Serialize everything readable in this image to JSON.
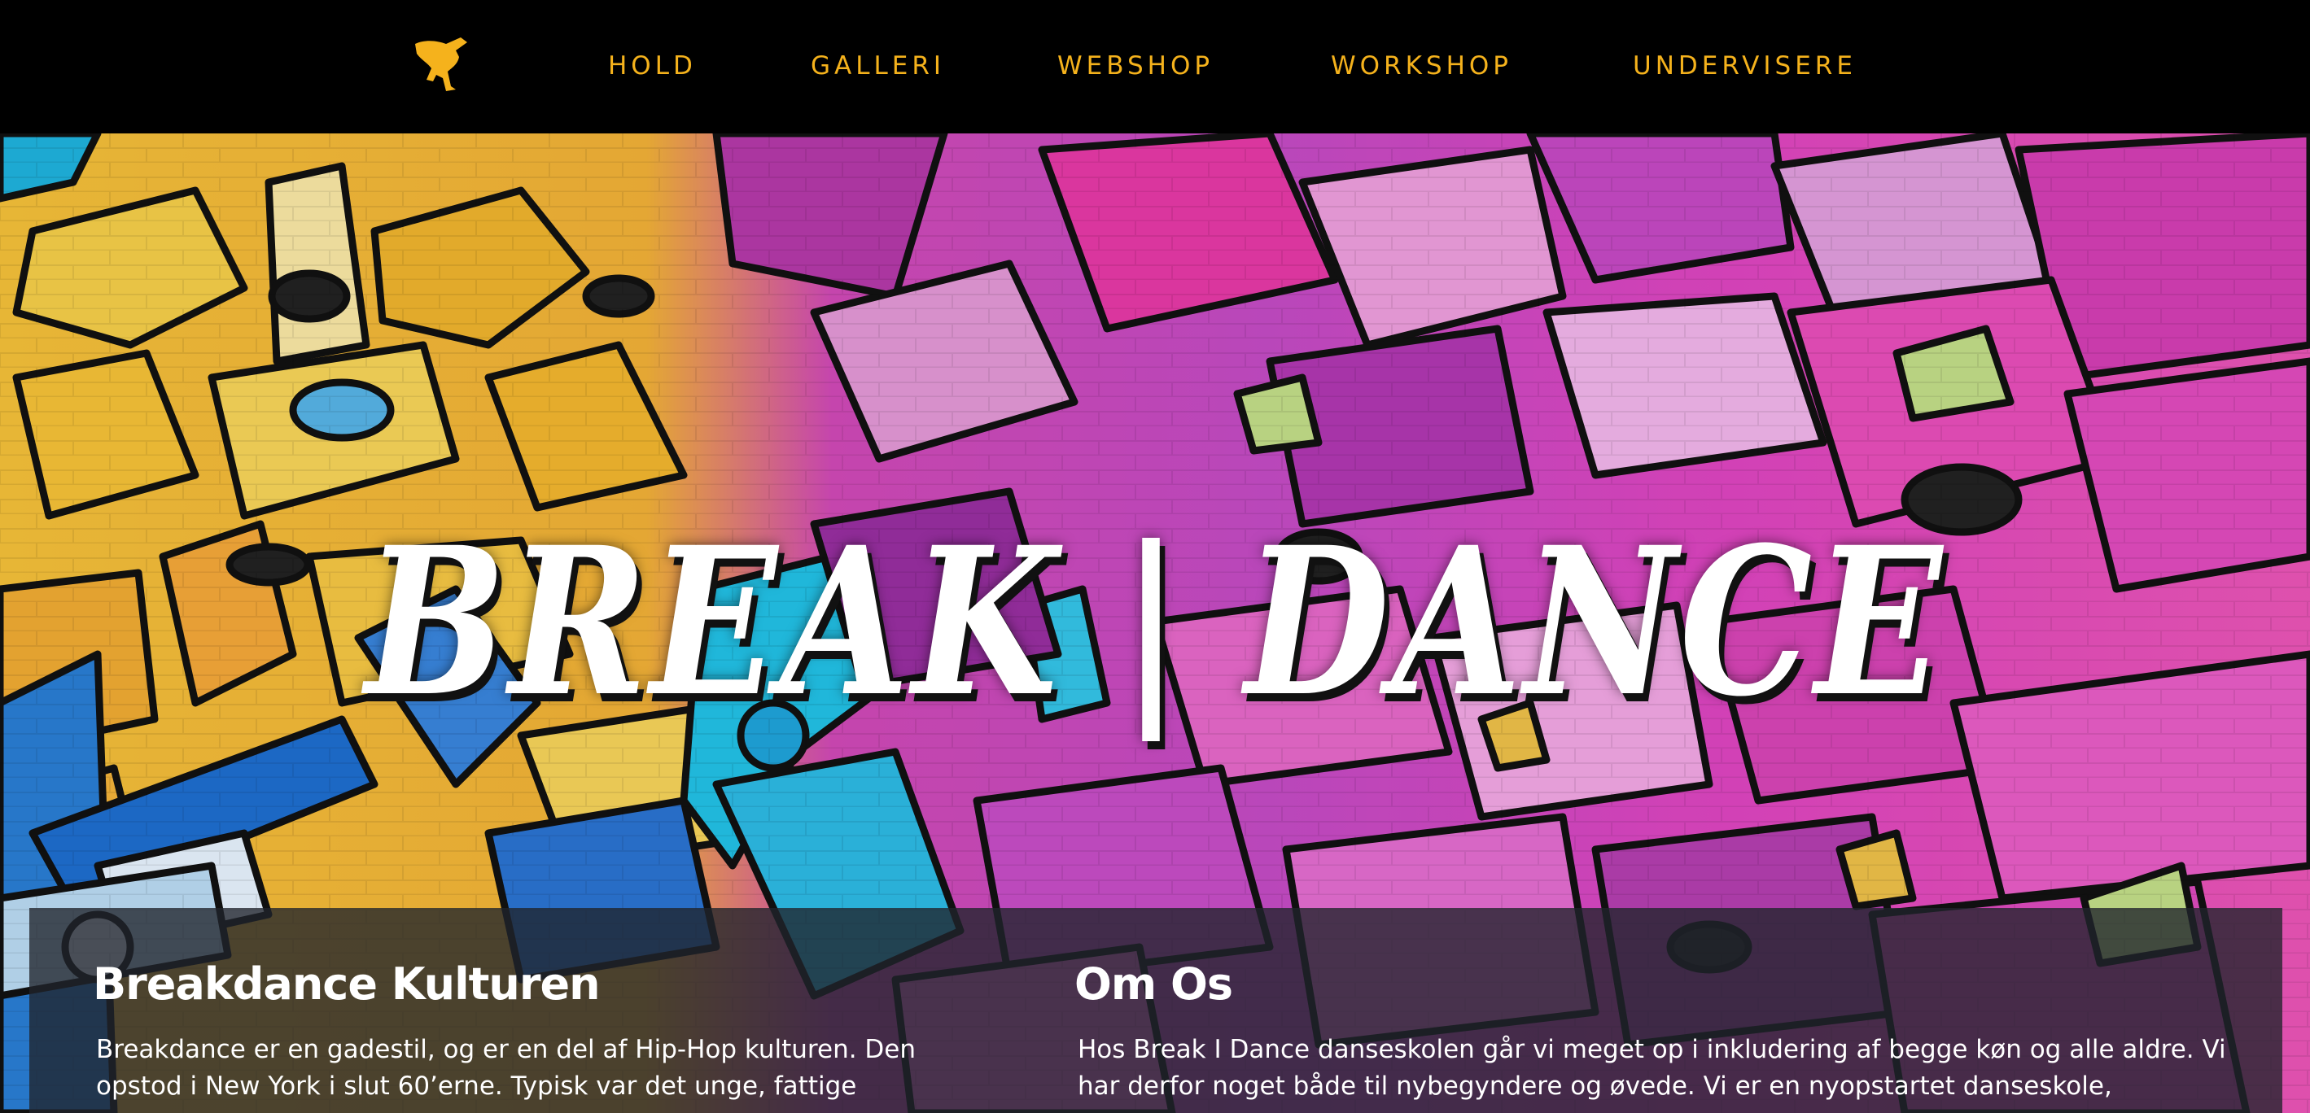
{
  "nav": {
    "logo_icon": "breakdancer-logo-icon",
    "items": [
      {
        "label": "HOLD"
      },
      {
        "label": "GALLERI"
      },
      {
        "label": "WEBSHOP"
      },
      {
        "label": "WORKSHOP"
      },
      {
        "label": "UNDERVISERE"
      }
    ],
    "color": "#f5b21c"
  },
  "hero": {
    "title": "BREAK | DANCE"
  },
  "sections": {
    "culture": {
      "heading": "Breakdance Kulturen",
      "text": "Breakdance er en gadestil, og er en del af Hip-Hop kulturen. Den opstod i New York i slut 60’erne. Typisk var det unge, fattige"
    },
    "about": {
      "heading": "Om Os",
      "text": "Hos Break I Dance danseskolen går vi meget op i inkludering af begge køn og alle aldre. Vi har derfor noget både til nybegyndere og øvede. Vi er en nyopstartet danseskole,"
    }
  }
}
